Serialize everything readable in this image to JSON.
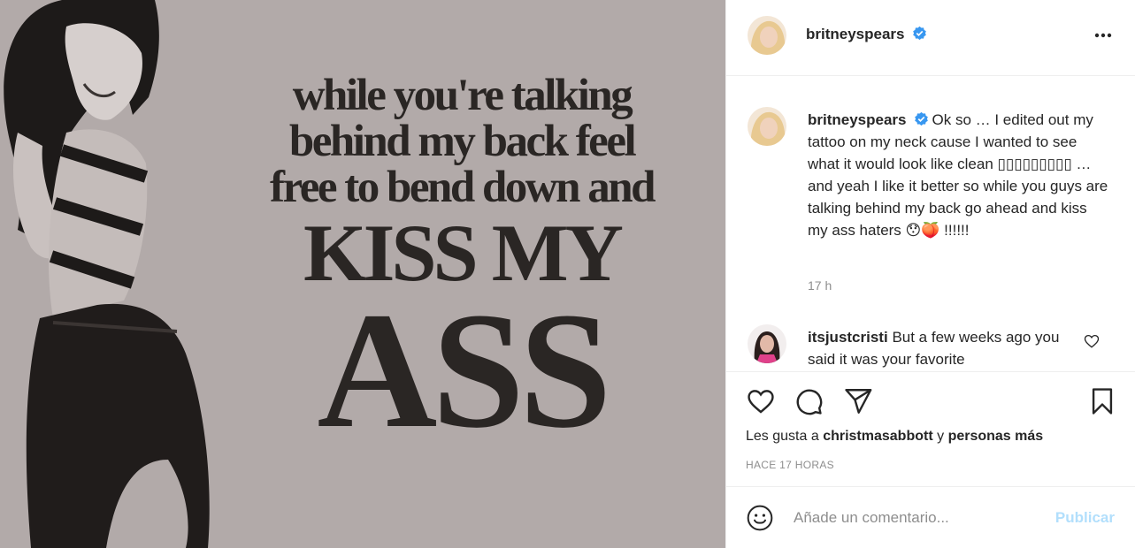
{
  "post": {
    "image_quote": {
      "line1": "while you're talking",
      "line2": "behind my back feel",
      "line3": "free to bend down and",
      "line4": "KISS MY",
      "line5": "ASS"
    },
    "author": {
      "username": "britneyspears",
      "verified": true
    },
    "caption": {
      "username": "britneyspears",
      "text": "Ok so … I edited out my tattoo on my neck cause I wanted to see what it would look like clean ▯▯▯▯▯▯▯▯▯ … and yeah I like it better so while you guys are talking behind my back go ahead and kiss my ass haters 😯🍑 !!!!!!",
      "time": "17 h"
    },
    "comments": [
      {
        "username": "itsjustcristi",
        "text": "But a few weeks ago you said it was your favorite"
      }
    ],
    "likes": {
      "prefix": "Les gusta a",
      "user": "christmasabbott",
      "connector": "y",
      "others": "personas más"
    },
    "posted_ago": "HACE 17 HORAS",
    "add_comment": {
      "placeholder": "Añade un comentario...",
      "publish_label": "Publicar"
    },
    "icons": {
      "more": "more-options-icon",
      "like": "heart-icon",
      "comment": "comment-bubble-icon",
      "share": "paper-plane-icon",
      "save": "bookmark-icon",
      "emoji": "smiley-icon",
      "verified": "verified-badge-icon"
    },
    "colors": {
      "verified": "#3897f0",
      "publish_disabled": "#b2dffc",
      "muted": "#8e8e8e",
      "image_bg": "#b2aaa9"
    }
  }
}
